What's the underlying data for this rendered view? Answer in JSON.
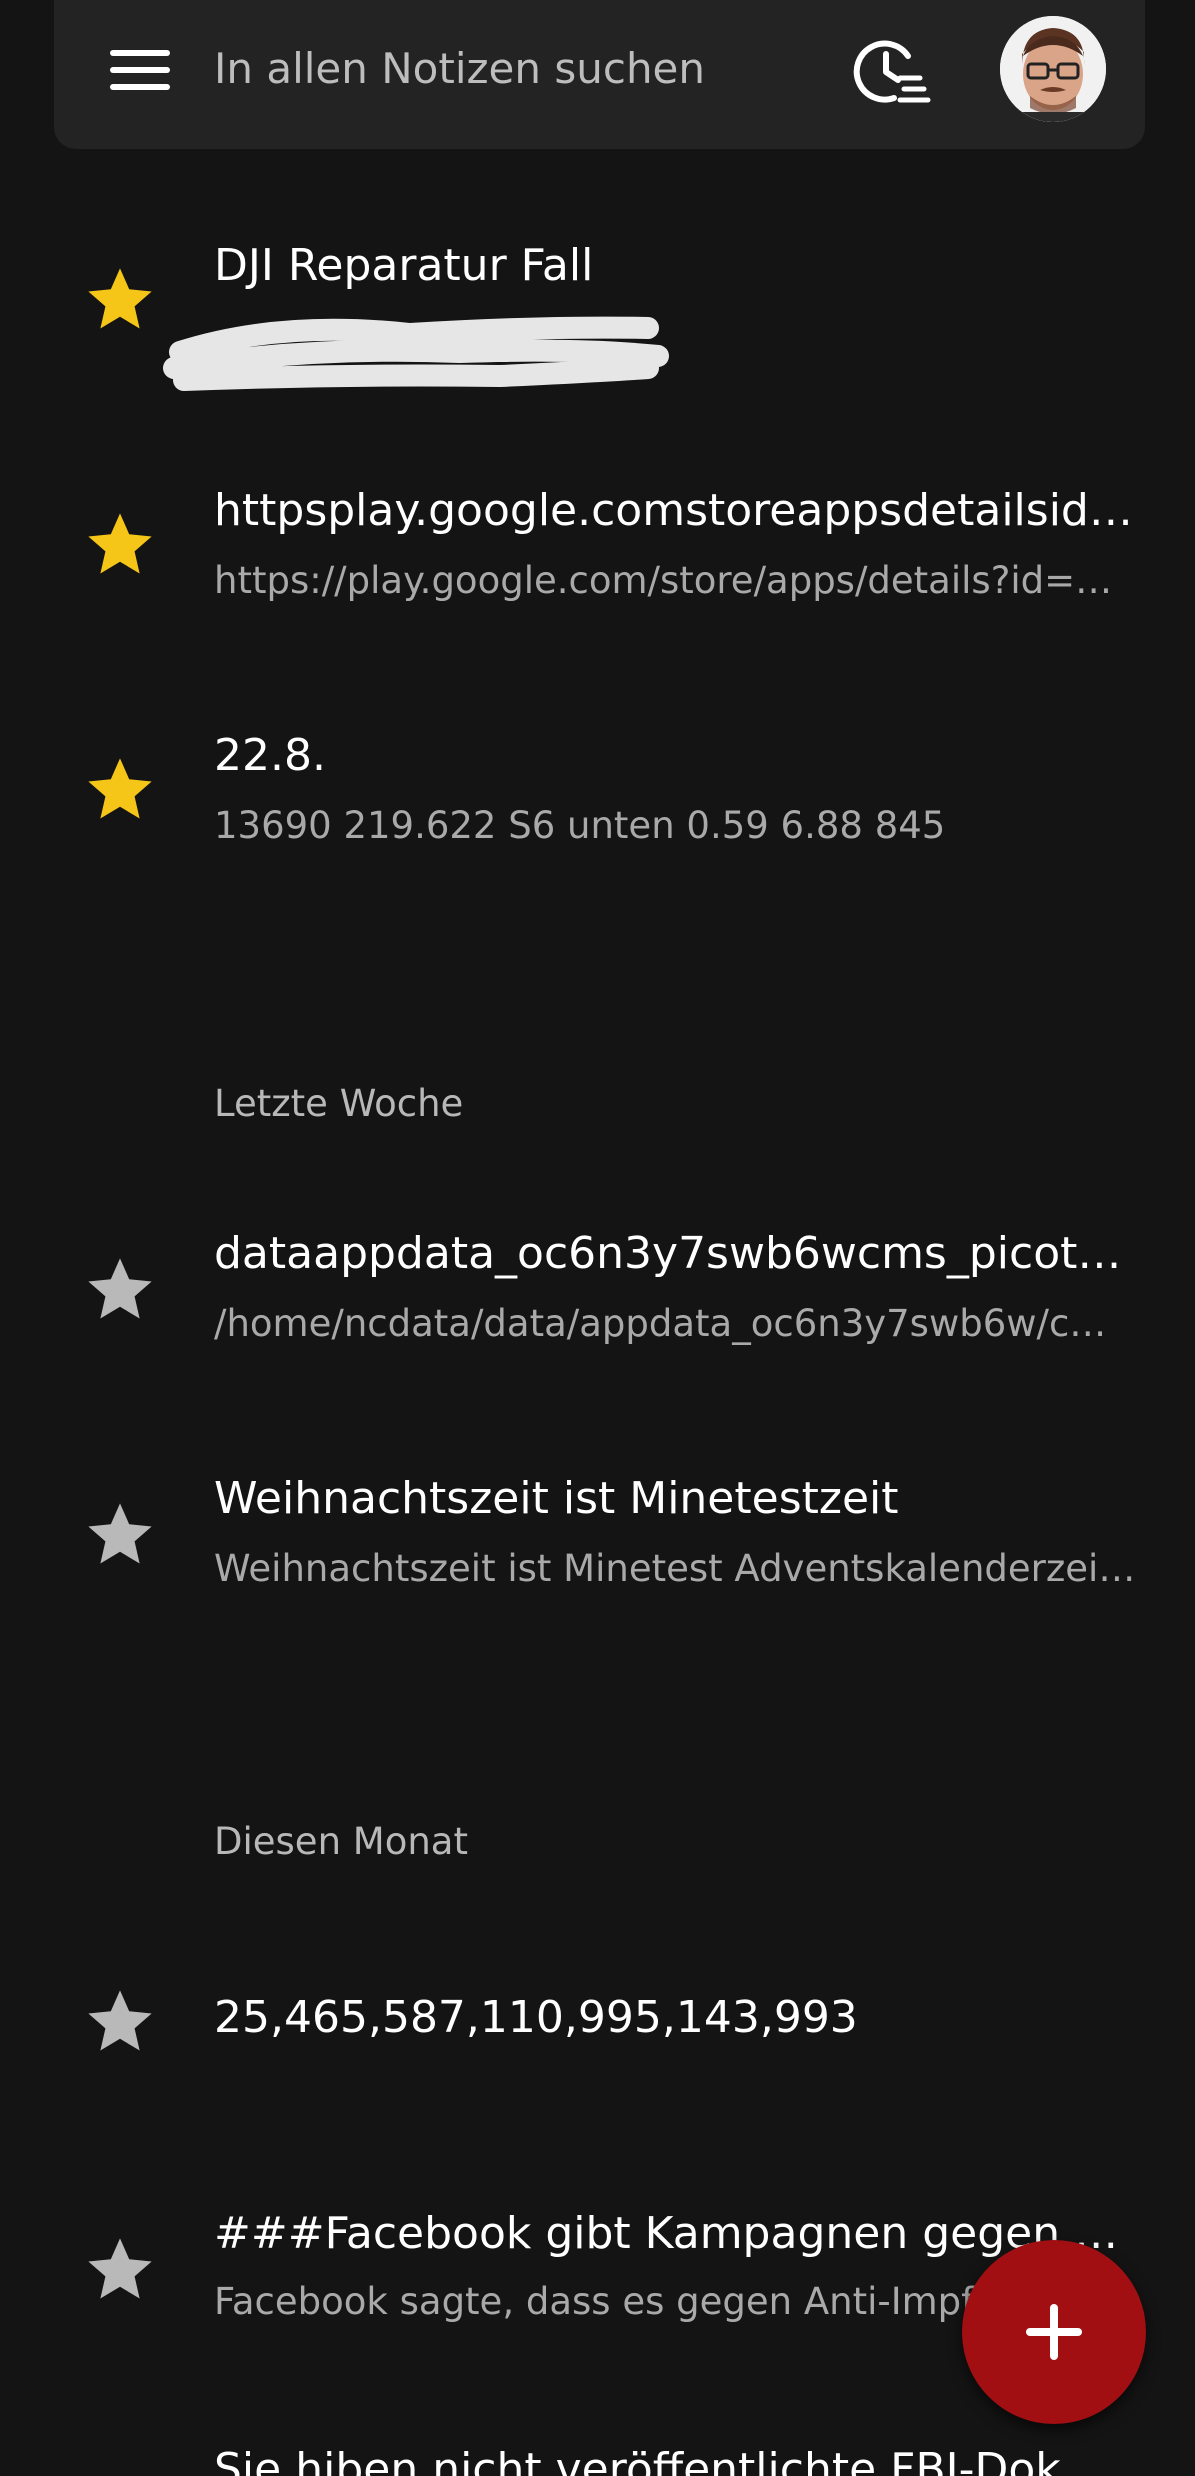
{
  "search": {
    "placeholder": "In allen Notizen suchen"
  },
  "icons": {
    "menu": "hamburger-menu-icon",
    "history": "clock-list-icon",
    "star_favorite": "star-filled-icon",
    "star_normal": "star-outline-icon",
    "add": "plus-icon"
  },
  "colors": {
    "background": "#141414",
    "surface": "#232323",
    "favorite_star": "#f5c518",
    "normal_star": "#b9b9b9",
    "fab": "#a10f12"
  },
  "notes_pinned": [
    {
      "title": "DJI Reparatur Fall",
      "excerpt": "",
      "favorite": true
    },
    {
      "title": "httpsplay.google.comstoreappsdetailsid=co…",
      "excerpt": "https://play.google.com/store/apps/details?id=…",
      "favorite": true
    },
    {
      "title": "22.8.",
      "excerpt": "13690   219.622   S6 unten 0.59 6.88 845",
      "favorite": true
    }
  ],
  "sections": [
    {
      "label": "Letzte Woche",
      "notes": [
        {
          "title": "dataappdata_oc6n3y7swb6wcms_picothe…",
          "excerpt": "/home/ncdata/data/appdata_oc6n3y7swb6w/c…",
          "favorite": false
        },
        {
          "title": "Weihnachtszeit ist Minetestzeit",
          "excerpt": "Weihnachtszeit ist Minetest Adventskalenderzeit …",
          "favorite": false
        }
      ]
    },
    {
      "label": "Diesen Monat",
      "notes": [
        {
          "title": "25,465,587,110,995,143,993",
          "excerpt": "",
          "favorite": false
        },
        {
          "title": "###Facebook gibt Kampagnen gegen das …",
          "excerpt": "Facebook sagte, dass es gegen Anti-Impf…",
          "favorite": false
        },
        {
          "title": "Sie hiben nicht veröffentlichte FBI-Dok…",
          "excerpt": "",
          "favorite": false
        }
      ]
    }
  ]
}
